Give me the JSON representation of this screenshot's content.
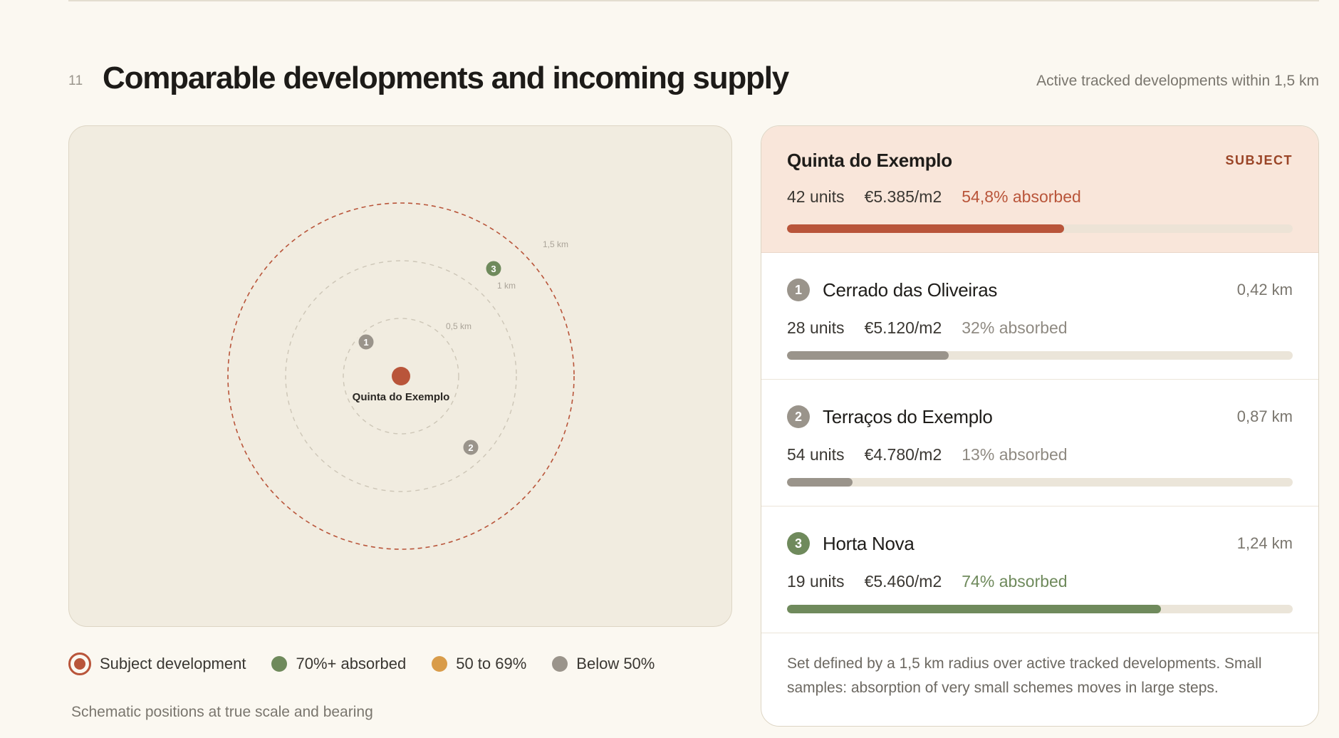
{
  "section": {
    "number": "11",
    "title": "Comparable developments and incoming supply",
    "meta": "Active tracked developments within 1,5 km"
  },
  "colors": {
    "subject": "#b9553a",
    "high": "#6f8a5c",
    "mid": "#d99c4a",
    "low": "#9a948b"
  },
  "map": {
    "rings": [
      {
        "label": "0,5 km",
        "km": 0.5
      },
      {
        "label": "1 km",
        "km": 1.0
      },
      {
        "label": "1,5 km",
        "km": 1.5
      }
    ],
    "subject_label": "Quinta do Exemplo",
    "markers": [
      {
        "label": "1",
        "distance_km": 0.42,
        "tier": "low"
      },
      {
        "label": "2",
        "distance_km": 0.87,
        "tier": "low"
      },
      {
        "label": "3",
        "distance_km": 1.24,
        "tier": "high"
      }
    ],
    "note": "Schematic positions at true scale and bearing"
  },
  "legend": [
    {
      "label": "Subject development",
      "icon": "subject-ring-icon"
    },
    {
      "label": "70%+ absorbed",
      "icon": "green-dot-icon"
    },
    {
      "label": "50 to 69%",
      "icon": "amber-dot-icon"
    },
    {
      "label": "Below 50%",
      "icon": "grey-dot-icon"
    }
  ],
  "subject": {
    "name": "Quinta do Exemplo",
    "tag": "SUBJECT",
    "units": "42 units",
    "price": "€5.385/m2",
    "absorbed": "54,8% absorbed",
    "absorbed_pct": 54.8
  },
  "comparables": [
    {
      "index": "1",
      "name": "Cerrado das Oliveiras",
      "distance": "0,42 km",
      "units": "28 units",
      "price": "€5.120/m2",
      "absorbed": "32% absorbed",
      "absorbed_pct": 32,
      "tier": "low"
    },
    {
      "index": "2",
      "name": "Terraços do Exemplo",
      "distance": "0,87 km",
      "units": "54 units",
      "price": "€4.780/m2",
      "absorbed": "13% absorbed",
      "absorbed_pct": 13,
      "tier": "low"
    },
    {
      "index": "3",
      "name": "Horta Nova",
      "distance": "1,24 km",
      "units": "19 units",
      "price": "€5.460/m2",
      "absorbed": "74% absorbed",
      "absorbed_pct": 74,
      "tier": "high"
    }
  ],
  "footnote": "Set defined by a 1,5 km radius over active tracked developments. Small samples: absorption of very small schemes moves in large steps."
}
